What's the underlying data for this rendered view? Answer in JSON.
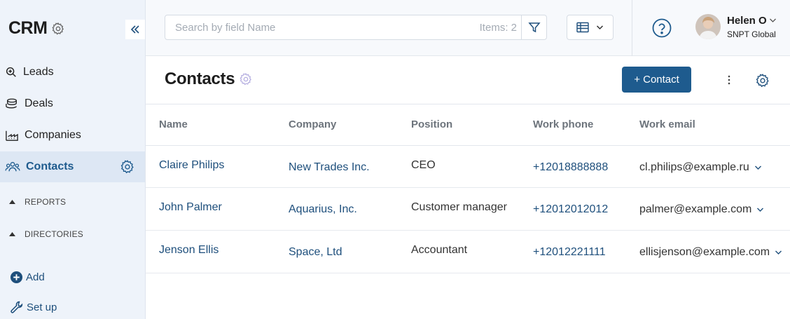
{
  "sidebar": {
    "title": "CRM",
    "nav": [
      {
        "label": "Leads",
        "icon": "leads-search-icon"
      },
      {
        "label": "Deals",
        "icon": "deals-stack-icon"
      },
      {
        "label": "Companies",
        "icon": "companies-factory-icon"
      },
      {
        "label": "Contacts",
        "icon": "contacts-people-icon",
        "active": true
      }
    ],
    "sections": [
      {
        "label": "REPORTS"
      },
      {
        "label": "DIRECTORIES"
      }
    ],
    "actions": [
      {
        "label": "Add",
        "icon": "plus-circle-icon"
      },
      {
        "label": "Set up",
        "icon": "wrench-icon"
      }
    ]
  },
  "header": {
    "search_placeholder": "Search by field Name",
    "items_count": "Items: 2",
    "user_name": "Helen O",
    "user_org": "SNPT Global"
  },
  "page": {
    "title": "Contacts",
    "add_button": "+ Contact"
  },
  "table": {
    "columns": [
      "Name",
      "Company",
      "Position",
      "Work phone",
      "Work email"
    ],
    "rows": [
      {
        "name": "Claire Philips",
        "company": "New Trades Inc.",
        "position": "CEO",
        "phone": "+12018888888",
        "email": "cl.philips@example.ru"
      },
      {
        "name": "John Palmer",
        "company": "Aquarius, Inc.",
        "position": "Customer manager",
        "phone": "+12012012012",
        "email": "palmer@example.com"
      },
      {
        "name": "Jenson Ellis",
        "company": "Space, Ltd",
        "position": "Accountant",
        "phone": "+12012221111",
        "email": "ellisjenson@example.com"
      }
    ]
  },
  "colors": {
    "accent": "#1e5b8e",
    "link": "#1e4f7c",
    "sidebar_bg": "#eef3fa",
    "sidebar_active": "#dde7f4"
  }
}
